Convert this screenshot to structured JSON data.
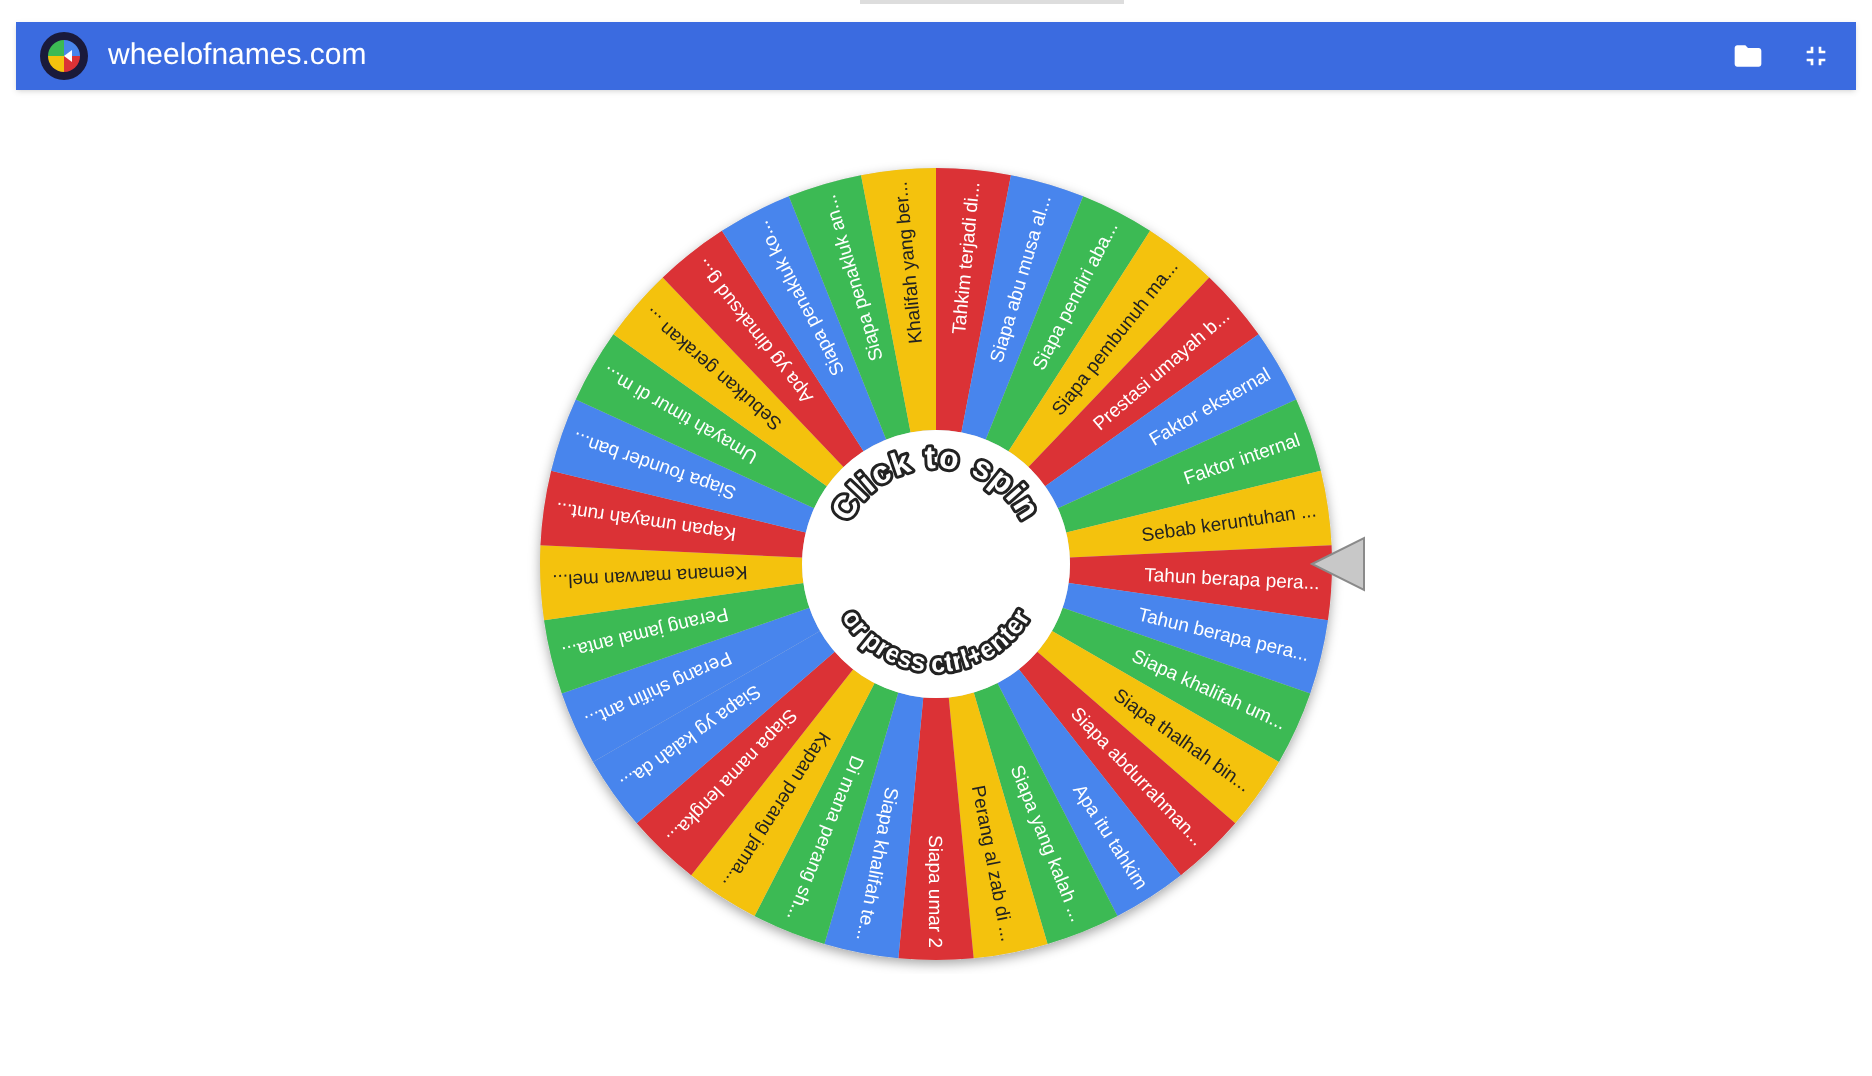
{
  "header": {
    "title": "wheelofnames.com"
  },
  "wheel": {
    "spin_prompt": "Click to spin",
    "shortcut_prompt": "or press ctrl+enter",
    "entries": [
      {
        "label": "Tahkim terjadi di...",
        "color": "#db3236"
      },
      {
        "label": "Siapa abu musa al...",
        "color": "#4885ed"
      },
      {
        "label": "Siapa pendiri aba...",
        "color": "#3cba54"
      },
      {
        "label": "Siapa pembunuh ma...",
        "color": "#f4c20d"
      },
      {
        "label": "Prestasi umayah b...",
        "color": "#db3236"
      },
      {
        "label": "Faktor eksternal",
        "color": "#4885ed"
      },
      {
        "label": "Faktor internal",
        "color": "#3cba54"
      },
      {
        "label": "Sebab keruntuhan ...",
        "color": "#f4c20d"
      },
      {
        "label": "Tahun berapa pera...",
        "color": "#db3236"
      },
      {
        "label": "Tahun berapa pera...",
        "color": "#4885ed"
      },
      {
        "label": "Siapa khalifah um...",
        "color": "#3cba54"
      },
      {
        "label": "Siapa thalhah bin...",
        "color": "#f4c20d"
      },
      {
        "label": "Siapa abdurrahman...",
        "color": "#db3236"
      },
      {
        "label": "Apa itu tahkim",
        "color": "#4885ed"
      },
      {
        "label": "Siapa yang kalah ...",
        "color": "#3cba54"
      },
      {
        "label": "Perang al zab di ...",
        "color": "#f4c20d"
      },
      {
        "label": "Siapa umar 2",
        "color": "#db3236"
      },
      {
        "label": "Siapa khalifah te...",
        "color": "#4885ed"
      },
      {
        "label": "Di mana perang sh...",
        "color": "#3cba54"
      },
      {
        "label": "Kapan perang jama...",
        "color": "#f4c20d"
      },
      {
        "label": "Siapa nama lengka...",
        "color": "#db3236"
      },
      {
        "label": "Siapa yg kalah da...",
        "color": "#4885ed"
      },
      {
        "label": "Perang shifin ant...",
        "color": "#4885ed"
      },
      {
        "label": "Perang jamal anta...",
        "color": "#3cba54"
      },
      {
        "label": "Kemana marwan mel...",
        "color": "#f4c20d"
      },
      {
        "label": "Kapan umayah runt...",
        "color": "#db3236"
      },
      {
        "label": "Siapa founder ban...",
        "color": "#4885ed"
      },
      {
        "label": "Umayah timur di m...",
        "color": "#3cba54"
      },
      {
        "label": "Sebutkan gerakan ...",
        "color": "#f4c20d"
      },
      {
        "label": "Apa yg dimaksud g...",
        "color": "#db3236"
      },
      {
        "label": "Siapa penakluk ko...",
        "color": "#4885ed"
      },
      {
        "label": "Siapa penakluk an...",
        "color": "#3cba54"
      },
      {
        "label": "Khalifah yang ber...",
        "color": "#f4c20d"
      }
    ]
  }
}
